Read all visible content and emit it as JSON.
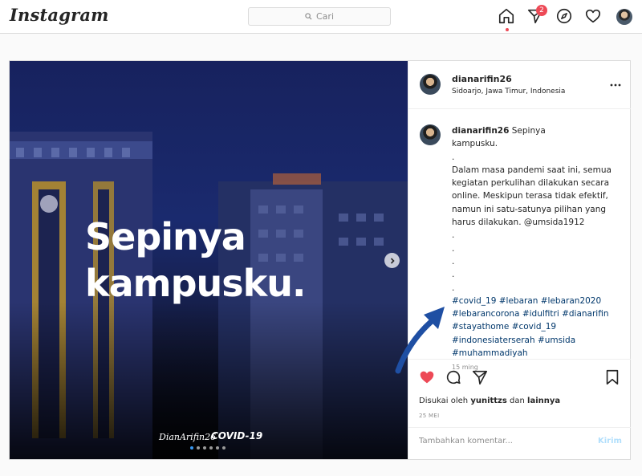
{
  "nav": {
    "logo": "Instagram",
    "search_placeholder": "Cari",
    "notification_count": "2",
    "icons": [
      "home-icon",
      "direct-icon",
      "explore-icon",
      "activity-heart-icon",
      "profile-avatar"
    ]
  },
  "media": {
    "overlay_line1": "Sepinya",
    "overlay_line2": "kampusku.",
    "signature": "DianArifin26",
    "label": "COVID-19",
    "carousel_dots": 6,
    "active_dot": 0
  },
  "post_header": {
    "username": "dianarifin26",
    "location": "Sidoarjo, Jawa Timur, Indonesia"
  },
  "caption": {
    "username": "dianarifin26",
    "first": "Sepinya",
    "lines": [
      "kampusku.",
      ".",
      "Dalam masa pandemi saat ini, semua",
      "kegiatan perkulihan dilakukan secara",
      "online. Meskipun terasa tidak efektif,",
      "namun ini satu-satunya pilihan yang",
      "harus dilakukan. @umsida1912",
      ".",
      ".",
      ".",
      ".",
      "."
    ],
    "hashtag_lines": [
      "#covid_19 #lebaran #lebaran2020",
      "#lebarancorona #idulfitri #dianarifin",
      "#stayathome #covid_19",
      "#indonesiaterserah #umsida",
      "#muhammadiyah"
    ],
    "time": "15 ming"
  },
  "actions": {
    "liked_by_prefix": "Disukai oleh",
    "liked_by_user": "yunittzs",
    "liked_by_and": "dan",
    "liked_by_others": "lainnya",
    "date": "25 MEI",
    "comment_placeholder": "Tambahkan komentar...",
    "post_label": "Kirim"
  },
  "colors": {
    "like_red": "#ed4956",
    "link_blue": "#00376b",
    "arrow_blue": "#1f4fa3",
    "post_button_disabled": "#b2dffc"
  }
}
